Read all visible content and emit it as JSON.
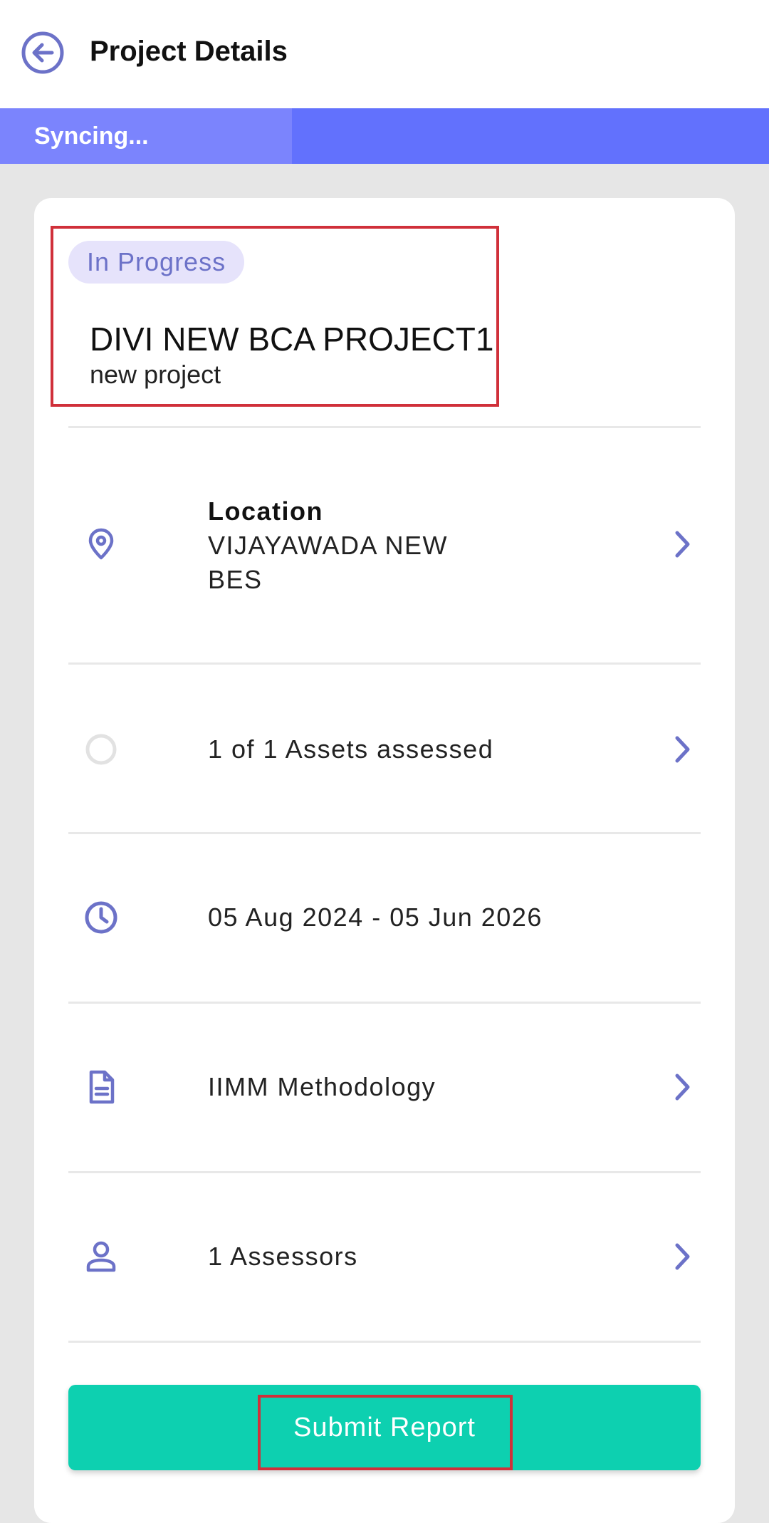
{
  "header": {
    "title": "Project Details",
    "back_icon": "arrow-left-circle-icon"
  },
  "sync": {
    "label": "Syncing...",
    "progress": 0.38
  },
  "project": {
    "status": "In Progress",
    "name": "DIVI NEW BCA PROJECT1",
    "description": "new project"
  },
  "details": {
    "location": {
      "icon": "map-pin-icon",
      "label": "Location",
      "value_line1": "VIJAYAWADA NEW",
      "value_line2": "BES"
    },
    "assets": {
      "icon": "circle-outline-icon",
      "text": "1 of 1 Assets assessed"
    },
    "dates": {
      "icon": "clock-icon",
      "text": "05 Aug 2024 - 05 Jun 2026"
    },
    "methodology": {
      "icon": "document-icon",
      "text": "IIMM Methodology"
    },
    "assessors": {
      "icon": "person-icon",
      "text": "1 Assessors"
    }
  },
  "actions": {
    "submit_label": "Submit Report"
  },
  "colors": {
    "accent": "#6271fd",
    "icon": "#6c72c8",
    "submit": "#0dd0b0",
    "badge_bg": "#e6e3fb",
    "highlight": "#d0303a"
  }
}
